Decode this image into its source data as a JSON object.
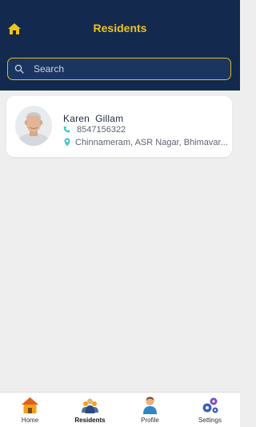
{
  "header": {
    "title": "Residents",
    "home_icon": "home-icon",
    "background_color": "#132a4e",
    "accent_color": "#f0c419"
  },
  "search": {
    "placeholder": "Search",
    "value": "",
    "icon": "search-icon",
    "border_color": "#e3b928"
  },
  "residents": [
    {
      "name": "Karen  Gillam",
      "phone": "8547156322",
      "address": "Chinnameram, ASR Nagar, Bhimavar...",
      "phone_icon": "phone-icon",
      "address_icon": "location-pin-icon",
      "icon_color": "#3ec9c9"
    }
  ],
  "bottom_nav": {
    "active": "Residents",
    "items": [
      {
        "label": "Home",
        "icon": "house-icon"
      },
      {
        "label": "Residents",
        "icon": "residents-group-icon"
      },
      {
        "label": "Profile",
        "icon": "profile-person-icon"
      },
      {
        "label": "Settings",
        "icon": "settings-gears-icon"
      }
    ]
  }
}
